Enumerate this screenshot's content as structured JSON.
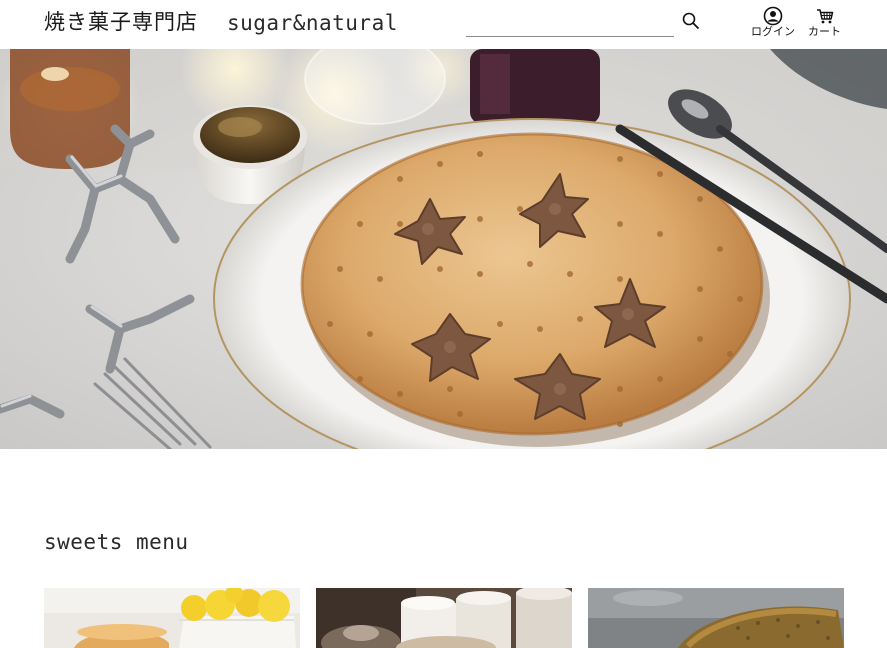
{
  "header": {
    "brand_jp": "焼き菓子専門店",
    "brand_en": "sugar&natural",
    "search": {
      "value": "",
      "placeholder": ""
    },
    "login_label": "ログイン",
    "cart_label": "カート"
  },
  "hero": {
    "image": "pie-with-star-cookies-on-plate"
  },
  "menu": {
    "title": "sweets menu",
    "cards": [
      {
        "image": "lemon-cake-with-lemons"
      },
      {
        "image": "tea-cups-and-pastry"
      },
      {
        "image": "baked-loaf"
      }
    ]
  },
  "icons": {
    "search": "search-icon",
    "user": "user-icon",
    "cart": "cart-icon"
  }
}
